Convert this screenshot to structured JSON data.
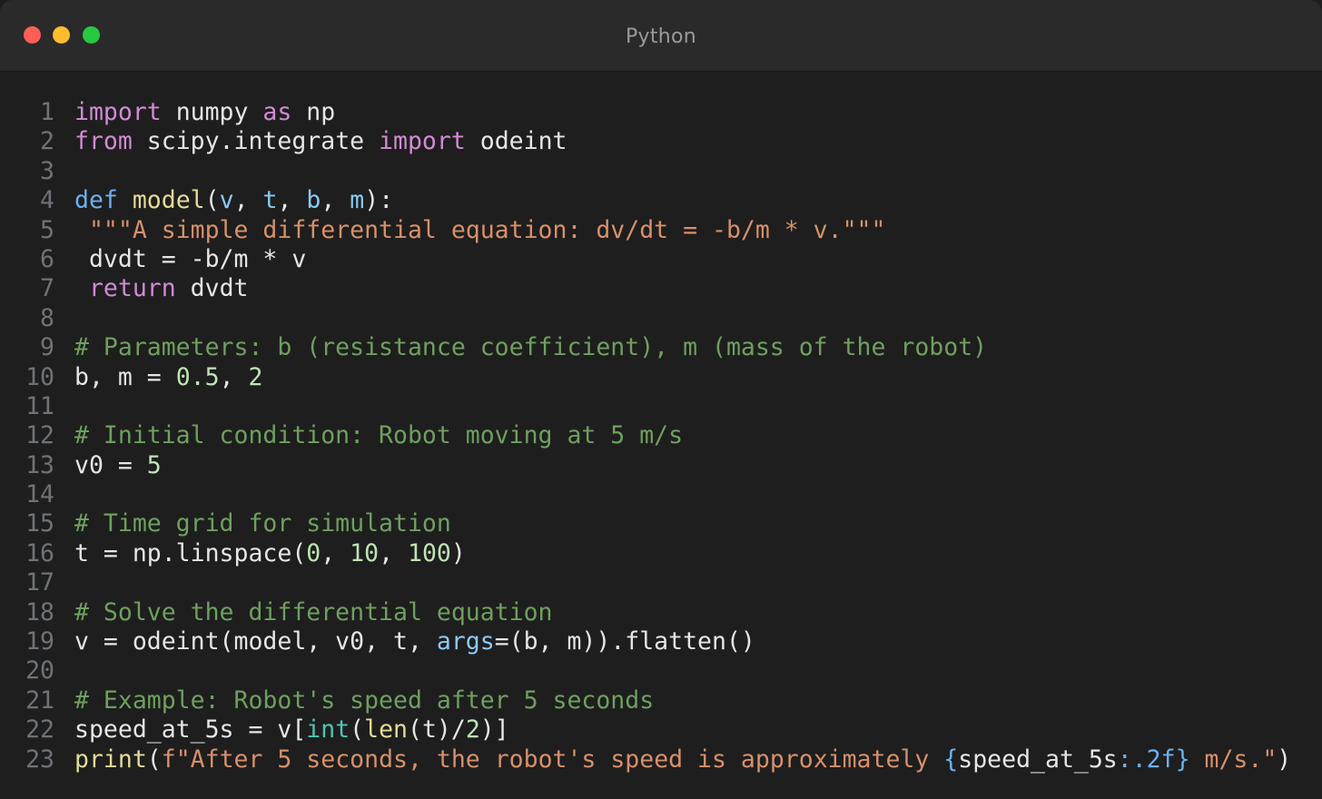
{
  "window": {
    "title": "Python",
    "controls": [
      "close",
      "minimize",
      "maximize"
    ]
  },
  "colors": {
    "plain": "#e6e6e6",
    "keyword": "#d28ad6",
    "def": "#6cb0f2",
    "funcname": "#e2dc97",
    "param": "#8cc9f5",
    "builtin": "#e2dc97",
    "string": "#d7906a",
    "comment": "#6ea05e",
    "number": "#bfe3b4",
    "type": "#4ec6b1",
    "fmt": "#6cb0f2"
  },
  "lines": [
    {
      "n": "1",
      "tokens": [
        [
          "import",
          "keyword"
        ],
        [
          " numpy ",
          "plain"
        ],
        [
          "as",
          "keyword"
        ],
        [
          " np",
          "plain"
        ]
      ]
    },
    {
      "n": "2",
      "tokens": [
        [
          "from",
          "keyword"
        ],
        [
          " scipy.integrate ",
          "plain"
        ],
        [
          "import",
          "keyword"
        ],
        [
          " odeint",
          "plain"
        ]
      ]
    },
    {
      "n": "3",
      "tokens": []
    },
    {
      "n": "4",
      "tokens": [
        [
          "def",
          "def"
        ],
        [
          " ",
          "plain"
        ],
        [
          "model",
          "funcname"
        ],
        [
          "(",
          "plain"
        ],
        [
          "v",
          "param"
        ],
        [
          ", ",
          "plain"
        ],
        [
          "t",
          "param"
        ],
        [
          ", ",
          "plain"
        ],
        [
          "b",
          "param"
        ],
        [
          ", ",
          "plain"
        ],
        [
          "m",
          "param"
        ],
        [
          "):",
          "plain"
        ]
      ]
    },
    {
      "n": "5",
      "tokens": [
        [
          " \"\"\"A simple differential equation: dv/dt = -b/m * v.\"\"\"",
          "string"
        ]
      ]
    },
    {
      "n": "6",
      "tokens": [
        [
          " dvdt = -b/m * v",
          "plain"
        ]
      ]
    },
    {
      "n": "7",
      "tokens": [
        [
          " ",
          "plain"
        ],
        [
          "return",
          "keyword"
        ],
        [
          " dvdt",
          "plain"
        ]
      ]
    },
    {
      "n": "8",
      "tokens": []
    },
    {
      "n": "9",
      "tokens": [
        [
          "# Parameters: b (resistance coefficient), m (mass of the robot)",
          "comment"
        ]
      ]
    },
    {
      "n": "10",
      "tokens": [
        [
          "b, m = ",
          "plain"
        ],
        [
          "0.5",
          "number"
        ],
        [
          ", ",
          "plain"
        ],
        [
          "2",
          "number"
        ]
      ]
    },
    {
      "n": "11",
      "tokens": []
    },
    {
      "n": "12",
      "tokens": [
        [
          "# Initial condition: Robot moving at 5 m/s",
          "comment"
        ]
      ]
    },
    {
      "n": "13",
      "tokens": [
        [
          "v0 = ",
          "plain"
        ],
        [
          "5",
          "number"
        ]
      ]
    },
    {
      "n": "14",
      "tokens": []
    },
    {
      "n": "15",
      "tokens": [
        [
          "# Time grid for simulation",
          "comment"
        ]
      ]
    },
    {
      "n": "16",
      "tokens": [
        [
          "t = np.linspace(",
          "plain"
        ],
        [
          "0",
          "number"
        ],
        [
          ", ",
          "plain"
        ],
        [
          "10",
          "number"
        ],
        [
          ", ",
          "plain"
        ],
        [
          "100",
          "number"
        ],
        [
          ")",
          "plain"
        ]
      ]
    },
    {
      "n": "17",
      "tokens": []
    },
    {
      "n": "18",
      "tokens": [
        [
          "# Solve the differential equation",
          "comment"
        ]
      ]
    },
    {
      "n": "19",
      "tokens": [
        [
          "v = odeint(model, v0, t, ",
          "plain"
        ],
        [
          "args",
          "param"
        ],
        [
          "=(b, m)).flatten()",
          "plain"
        ]
      ]
    },
    {
      "n": "20",
      "tokens": []
    },
    {
      "n": "21",
      "tokens": [
        [
          "# Example: Robot's speed after 5 seconds",
          "comment"
        ]
      ]
    },
    {
      "n": "22",
      "tokens": [
        [
          "speed_at_5s = v[",
          "plain"
        ],
        [
          "int",
          "type"
        ],
        [
          "(",
          "plain"
        ],
        [
          "len",
          "builtin"
        ],
        [
          "(t)/",
          "plain"
        ],
        [
          "2",
          "number"
        ],
        [
          ")]",
          "plain"
        ]
      ]
    },
    {
      "n": "23",
      "tokens": [
        [
          "print",
          "builtin"
        ],
        [
          "(",
          "plain"
        ],
        [
          "f\"After 5 seconds, the robot's speed is approximately ",
          "string"
        ],
        [
          "{",
          "fmt"
        ],
        [
          "speed_at_5s",
          "plain"
        ],
        [
          ":.2f}",
          "fmt"
        ],
        [
          " m/s.\"",
          "string"
        ],
        [
          ")",
          "plain"
        ]
      ]
    }
  ]
}
